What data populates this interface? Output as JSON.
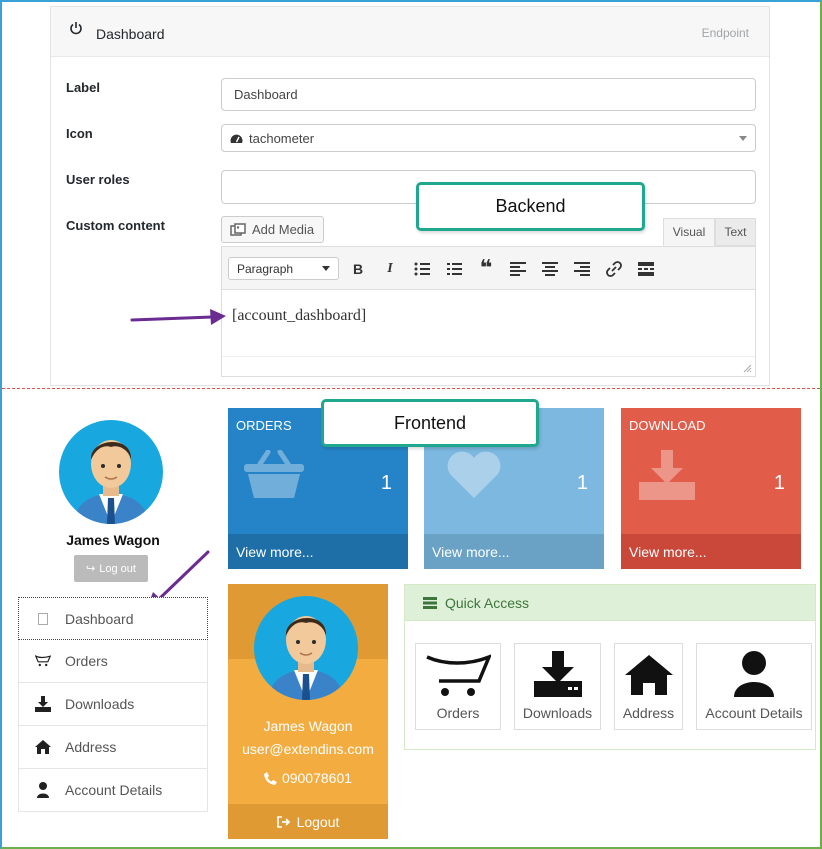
{
  "backend": {
    "header": {
      "title": "Dashboard",
      "endpoint": "Endpoint"
    },
    "fields": {
      "label": {
        "name": "Label",
        "value": "Dashboard"
      },
      "icon": {
        "name": "Icon",
        "value": "tachometer",
        "icon": "tachometer-icon"
      },
      "user_roles": {
        "name": "User roles",
        "value": ""
      },
      "custom_content": {
        "name": "Custom content"
      }
    },
    "editor": {
      "add_media": "Add Media",
      "tab_visual": "Visual",
      "tab_text": "Text",
      "format": "Paragraph",
      "content": "[account_dashboard]"
    }
  },
  "callouts": {
    "backend": "Backend",
    "frontend": "Frontend"
  },
  "frontend": {
    "user": {
      "name": "James Wagon",
      "logout_small": "Log out"
    },
    "nav": [
      {
        "label": "Dashboard",
        "icon": "blank-icon",
        "active": true
      },
      {
        "label": "Orders",
        "icon": "cart-icon"
      },
      {
        "label": "Downloads",
        "icon": "download-icon"
      },
      {
        "label": "Address",
        "icon": "home-icon"
      },
      {
        "label": "Account Details",
        "icon": "user-icon"
      }
    ],
    "tiles": [
      {
        "title": "ORDERS",
        "count": "1",
        "more": "View more...",
        "color": "#2584c7",
        "foot": "#1e6ea8",
        "icon": "basket-icon"
      },
      {
        "title": "",
        "count": "1",
        "more": "View more...",
        "color": "#7cb8df",
        "foot": "#6aa2c6",
        "icon": "heart-icon"
      },
      {
        "title": "DOWNLOAD",
        "count": "1",
        "more": "View more...",
        "color": "#e25c4a",
        "foot": "#c9483a",
        "icon": "download-icon"
      }
    ],
    "profile": {
      "name": "James Wagon",
      "email": "user@extendins.com",
      "phone": "090078601",
      "logout": "Logout"
    },
    "quick_access": {
      "title": "Quick Access",
      "items": [
        {
          "label": "Orders",
          "icon": "cart-icon"
        },
        {
          "label": "Downloads",
          "icon": "download-icon"
        },
        {
          "label": "Address",
          "icon": "home-icon"
        },
        {
          "label": "Account Details",
          "icon": "user-icon"
        }
      ]
    }
  },
  "colors": {
    "accent_callout": "#1fa88d",
    "arrow": "#6b2c91",
    "profile": "#f3ac40",
    "qa_head": "#dff0d8"
  }
}
